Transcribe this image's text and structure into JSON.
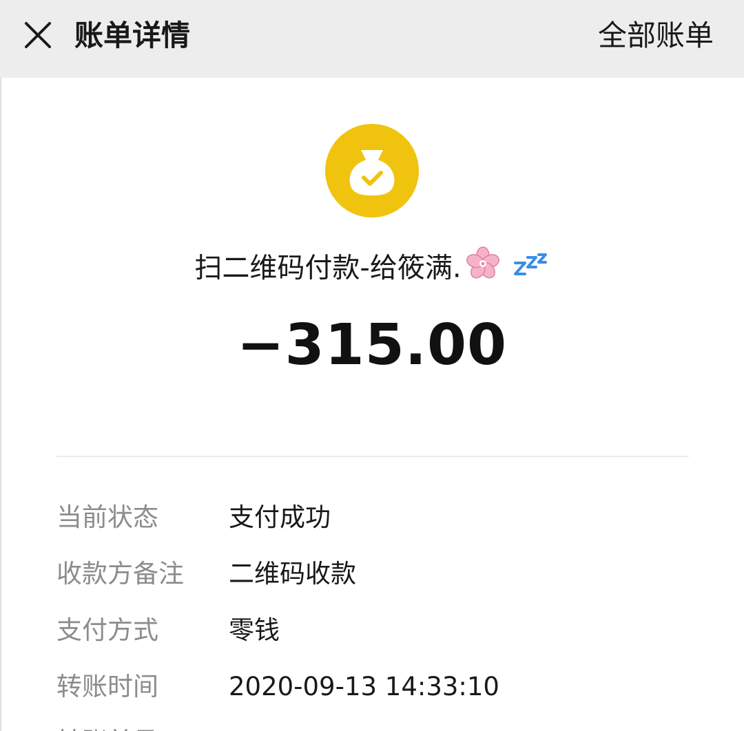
{
  "header": {
    "close_icon": "close-icon",
    "title": "账单详情",
    "all_bills_label": "全部账单"
  },
  "summary": {
    "icon": "money-bag-check-icon",
    "icon_color": "#f0c30f",
    "merchant_text": "扫二维码付款-给筱满.",
    "merchant_emojis": [
      "cherry-blossom-emoji",
      "zzz-emoji"
    ],
    "amount": "−315.00"
  },
  "details": [
    {
      "label": "当前状态",
      "value": "支付成功"
    },
    {
      "label": "收款方备注",
      "value": "二维码收款"
    },
    {
      "label": "支付方式",
      "value": "零钱"
    },
    {
      "label": "转账时间",
      "value": "2020-09-13 14:33:10"
    }
  ],
  "partial_row": {
    "label": "转账单号"
  }
}
